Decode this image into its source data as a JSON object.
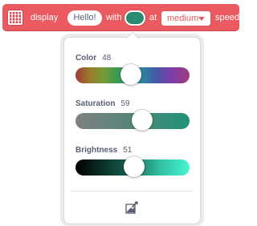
{
  "block": {
    "text_display": "display",
    "message_value": "Hello!",
    "text_with": "with",
    "text_at": "at",
    "speed_value": "medium",
    "text_speed": "speed",
    "block_color": "#ea5a60",
    "selected_color": "#2a8a73"
  },
  "popup": {
    "sliders": [
      {
        "label": "Color",
        "value": "48"
      },
      {
        "label": "Saturation",
        "value": "59"
      },
      {
        "label": "Brightness",
        "value": "51"
      }
    ],
    "eyedropper_icon": "eyedropper-icon"
  }
}
